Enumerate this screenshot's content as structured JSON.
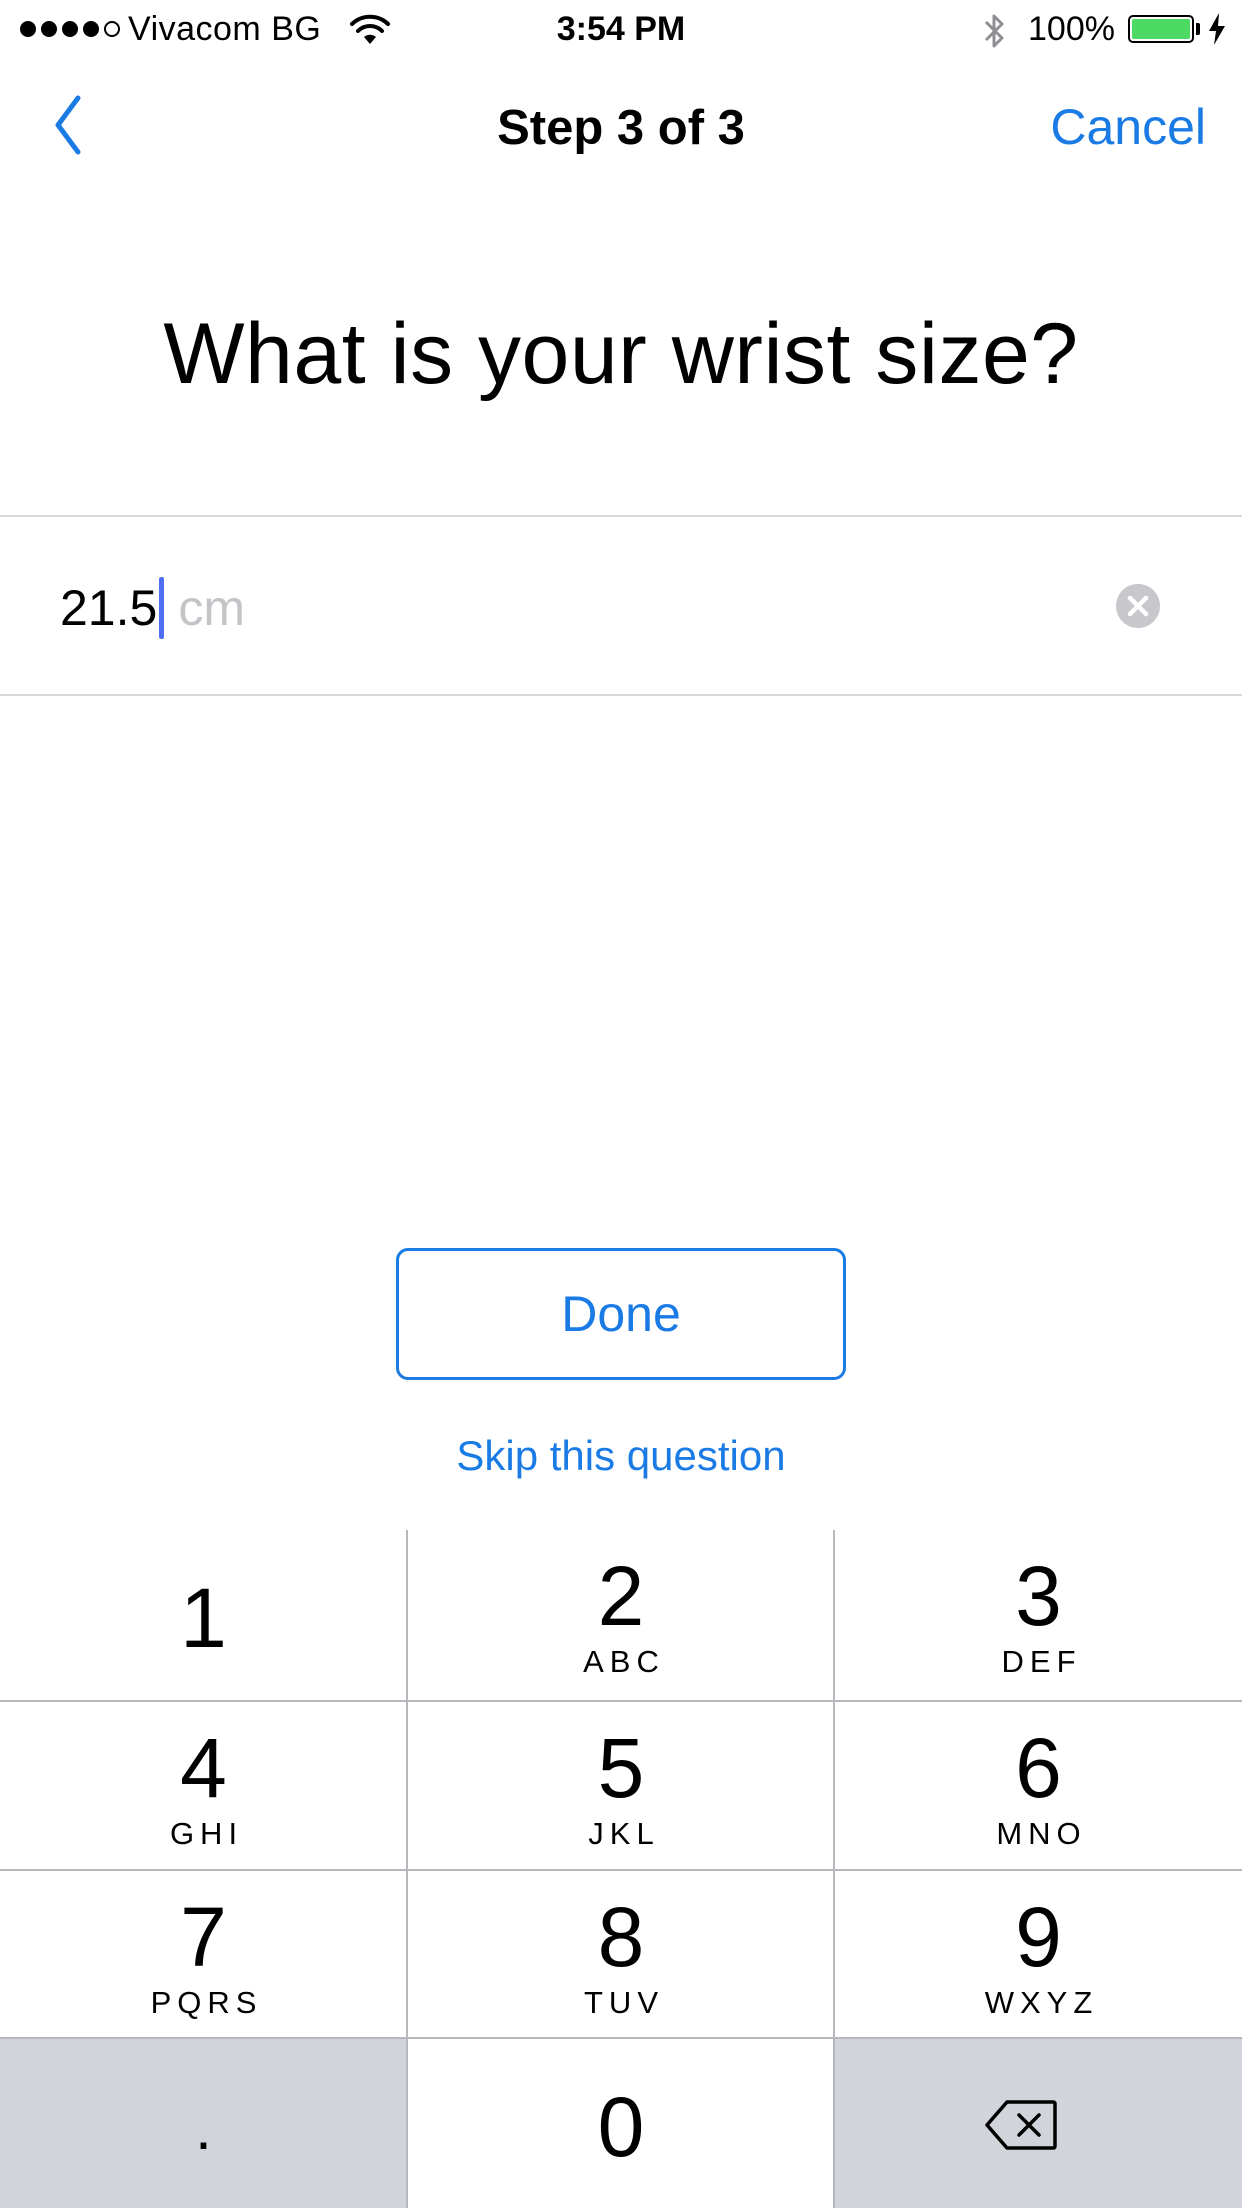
{
  "status_bar": {
    "signal_dots": [
      true,
      true,
      true,
      true,
      false
    ],
    "carrier": "Vivacom BG",
    "time": "3:54 PM",
    "battery_percent": "100%",
    "battery_level": 1.0,
    "battery_color": "#4cd964"
  },
  "nav": {
    "title": "Step 3 of 3",
    "cancel_label": "Cancel",
    "back_icon": "chevron-left-icon",
    "accent_color": "#1a7be5"
  },
  "question": "What is your wrist size?",
  "input": {
    "value": "21.5",
    "unit": "cm",
    "clear_icon": "clear-circle-icon"
  },
  "actions": {
    "done_label": "Done",
    "skip_label": "Skip this question"
  },
  "keypad": {
    "keys": [
      {
        "digit": "1",
        "letters": ""
      },
      {
        "digit": "2",
        "letters": "ABC"
      },
      {
        "digit": "3",
        "letters": "DEF"
      },
      {
        "digit": "4",
        "letters": "GHI"
      },
      {
        "digit": "5",
        "letters": "JKL"
      },
      {
        "digit": "6",
        "letters": "MNO"
      },
      {
        "digit": "7",
        "letters": "PQRS"
      },
      {
        "digit": "8",
        "letters": "TUV"
      },
      {
        "digit": "9",
        "letters": "WXYZ"
      }
    ],
    "decimal": ".",
    "zero": "0",
    "backspace_icon": "backspace-icon"
  }
}
